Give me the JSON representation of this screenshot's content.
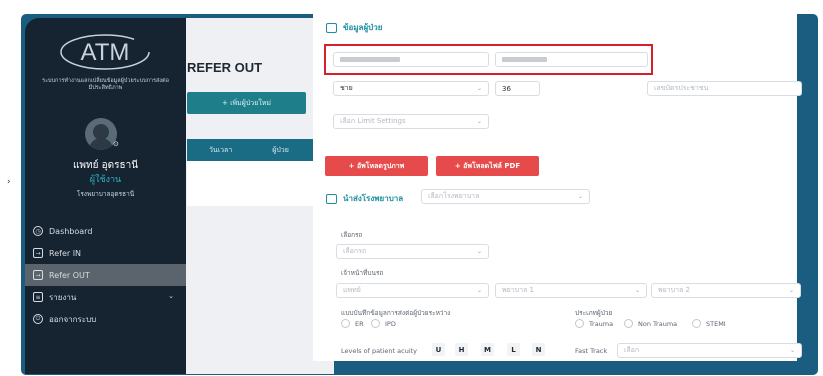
{
  "sidebar": {
    "logo_text": "ATM",
    "system_name_line1": "ระบบการทำงานแลกเปลี่ยนข้อมูลผู้ป่วยระบบการส่งต่อ",
    "system_name_line2": "มีประสิทธิภาพ",
    "doctor_name": "แพทย์ อุดรธานี",
    "role": "ผู้ใช้งาน",
    "hospital": "โรงพยาบาลอุดรธานี",
    "items": [
      {
        "label": "Dashboard",
        "icon": "clock-icon"
      },
      {
        "label": "Refer IN",
        "icon": "login-icon"
      },
      {
        "label": "Refer OUT",
        "icon": "logout-icon",
        "active": true
      },
      {
        "label": "รายงาน",
        "icon": "report-icon",
        "chevron": "⌄"
      },
      {
        "label": "ออกจากระบบ",
        "icon": "power-icon"
      }
    ]
  },
  "main": {
    "title": "REFER OUT",
    "add_button": "+ เพิ่มผู้ป่วยใหม่",
    "table_headers": [
      "วันเวลา",
      "ผู้ป่วย"
    ]
  },
  "form": {
    "patient_section_title": "ข้อมูลผู้ป่วย",
    "gender": "ชาย",
    "age": "36",
    "id_card_placeholder": "เลขบัตรประชาชน",
    "limit_placeholder": "เลือก Limit Settings",
    "upload_image_button": "+ อัพโหลดรูปภาพ",
    "upload_pdf_button": "+ อัพโหลดไฟล์ PDF",
    "hospital_section_title": "นำส่งโรงพยาบาล",
    "hospital_placeholder": "เลือกโรงพยาบาล",
    "vehicle_label": "เลือกรถ",
    "vehicle_placeholder": "เลือกรถ",
    "staff_label": "เจ้าหน้าที่บนรถ",
    "staff_doctor": "แพทย์",
    "staff_nurse1": "พยาบาล 1",
    "staff_nurse2": "พยาบาล 2",
    "record_label": "แบบบันทึกข้อมูลการส่งต่อผู้ป่วยระหว่าง",
    "record_options": [
      "ER",
      "IPD"
    ],
    "patient_type_label": "ประเภทผู้ป่วย",
    "patient_type_options": [
      "Trauma",
      "Non Trauma",
      "STEMI"
    ],
    "acuity_label": "Levels of patient acuity",
    "acuity_levels": [
      "U",
      "H",
      "M",
      "L",
      "N"
    ],
    "fast_track_label": "Fast Track",
    "fast_track_placeholder": "เลือก"
  },
  "colors": {
    "frame": "#1b5d80",
    "sidebar": "#162330",
    "accent": "#1e8fa3",
    "red": "#e64a4a",
    "highlight": "#d6202a"
  }
}
